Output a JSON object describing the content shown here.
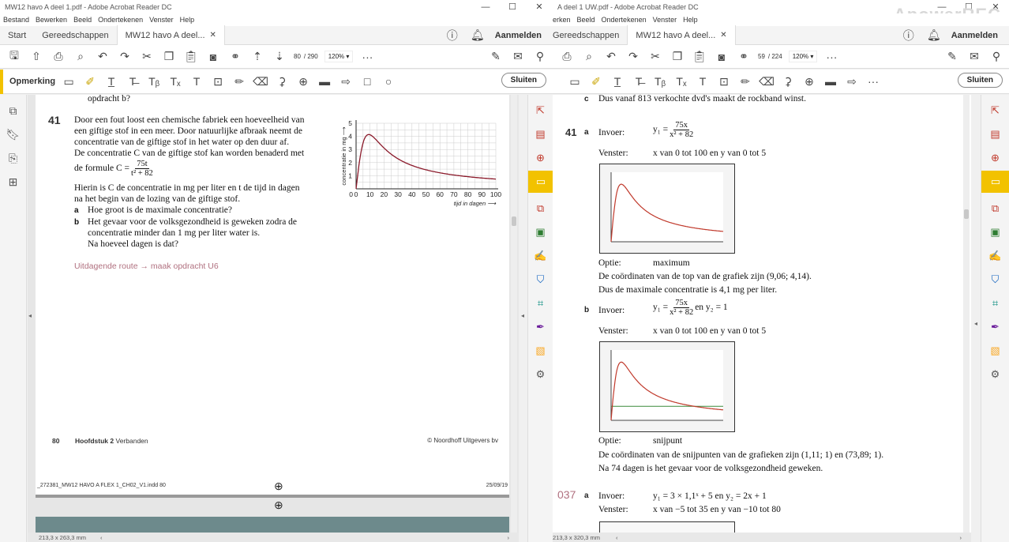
{
  "left": {
    "title": "MW12 havo A deel 1.pdf - Adobe Acrobat Reader DC",
    "menu": [
      "Bestand",
      "Bewerken",
      "Beeld",
      "Ondertekenen",
      "Venster",
      "Help"
    ],
    "tabs": [
      "Start",
      "Gereedschappen",
      "MW12 havo A deel..."
    ],
    "login": "Aanmelden",
    "page_current": "80",
    "page_total": "/ 290",
    "zoom": "120%",
    "comment_label": "Opmerking",
    "close_label": "Sluiten",
    "status": "213,3 x 263,3 mm",
    "content": {
      "top_line": "opdracht b?",
      "num": "41",
      "lines": [
        "Door een fout loost een chemische fabriek een hoeveelheid van",
        "een giftige stof in een meer. Door natuurlijke afbraak neemt de",
        "concentratie van de giftige stof in het water op den duur af.",
        "De concentratie C van de giftige stof kan worden benaderd met"
      ],
      "formula_prefix": "de formule C =",
      "formula_num": "75t",
      "formula_den": "t² + 82",
      "lines2": [
        "Hierin is C de concentratie in mg per liter en t de tijd in dagen",
        "na het begin van de lozing van de giftige stof."
      ],
      "qa_label": "a",
      "qa": "Hoe groot is de maximale concentratie?",
      "qb_label": "b",
      "qb": [
        "Het gevaar voor de volksgezondheid is geweken zodra de",
        "concentratie minder dan 1 mg per liter water is.",
        "Na hoeveel dagen is dat?"
      ],
      "route": "Uitdagende route → maak opdracht U6",
      "footer_page": "80",
      "footer_chapter": "Hoofdstuk 2",
      "footer_chapter_name": "Verbanden",
      "footer_copy": "© Noordhoff Uitgevers bv",
      "print_file": "_272381_MW12 HAVO A FLEX 1_CH02_V1.indd  80",
      "print_date": "25/09/19"
    },
    "chart_data": {
      "type": "line",
      "xlabel": "tijd in dagen",
      "ylabel": "concentratie in mg",
      "xticks": [
        0,
        10,
        20,
        30,
        40,
        50,
        60,
        70,
        80,
        90,
        100
      ],
      "yticks": [
        0,
        1,
        2,
        3,
        4,
        5
      ],
      "xlim": [
        0,
        100
      ],
      "ylim": [
        0,
        5
      ],
      "formula": "C = 75t/(t^2+82)",
      "series": [
        {
          "color": "#8b1a2b",
          "x": [
            0,
            1,
            2,
            3,
            5,
            7,
            9.06,
            12,
            15,
            20,
            25,
            30,
            40,
            50,
            60,
            70,
            80,
            90,
            100
          ],
          "y": [
            0,
            0.91,
            1.74,
            2.46,
            3.4,
            3.9,
            4.14,
            4.05,
            3.6,
            3.1,
            2.65,
            2.3,
            1.79,
            1.45,
            1.22,
            1.05,
            0.93,
            0.83,
            0.74
          ]
        }
      ]
    }
  },
  "right": {
    "title": "A deel 1 UW.pdf - Adobe Acrobat Reader DC",
    "menu": [
      "erken",
      "Beeld",
      "Ondertekenen",
      "Venster",
      "Help"
    ],
    "tabs": [
      "Gereedschappen",
      "MW12 havo A deel..."
    ],
    "login": "Aanmelden",
    "page_current": "59",
    "page_total": "/ 224",
    "zoom": "120%",
    "close_label": "Sluiten",
    "status": "213,3 x 320,3 mm",
    "watermark": "ApowerREC",
    "content": {
      "c_label": "c",
      "c_text": "Dus vanaf 813 verkochte dvd's maakt de rockband winst.",
      "num41": "41",
      "a_label": "a",
      "invoer": "Invoer:",
      "y1_prefix": "y₁ =",
      "y1_num": "75x",
      "y1_den": "x² + 82",
      "venster": "Venster:",
      "venster_a": "x van 0 tot 100 en y van 0 tot 5",
      "optie": "Optie:",
      "optie_a": "maximum",
      "a_res1": "De coördinaten van de top van de grafiek zijn (9,06; 4,14).",
      "a_res2": "Dus de maximale concentratie is 4,1 mg per liter.",
      "b_label": "b",
      "y2_text": "en y₂ = 1",
      "venster_b": "x van 0 tot 100 en y van 0 tot 5",
      "optie_b": "snijpunt",
      "b_res1": "De coördinaten van de snijpunten van de grafieken zijn (1,11; 1) en (73,89; 1).",
      "b_res2": "Na 74 dagen is het gevaar voor de volksgezondheid geweken.",
      "num37": "037",
      "a37_label": "a",
      "a37_invoer": "y₁ = 3 × 1,1ˣ + 5 en y₂ = 2x + 1",
      "a37_venster": "x van −5 tot 35 en y van −10 tot 80"
    }
  }
}
